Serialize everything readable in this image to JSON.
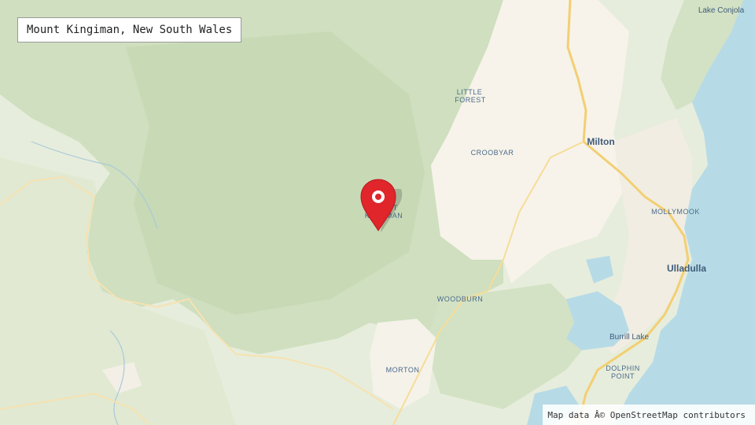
{
  "map": {
    "title": "Mount Kingiman, New South Wales",
    "attribution": "Map data Â© OpenStreetMap contributors",
    "colors": {
      "forest": "#cfdfbf",
      "forest_dark": "#c3d7b1",
      "land": "#e7eddc",
      "urban": "#f7f3ea",
      "water": "#b7dbe6",
      "road": "#f3cf72",
      "marker": "#e0252b"
    },
    "labels": {
      "lake_conjola": "Lake Conjola",
      "little_forest_1": "LITTLE",
      "little_forest_2": "FOREST",
      "croobyar": "CROOBYAR",
      "milton": "Milton",
      "mount_kingiman_1": "MOUNT",
      "mount_kingiman_2": "KINGIMAN",
      "mollymook": "MOLLYMOOK",
      "ulladulla": "Ulladulla",
      "woodburn": "WOODBURN",
      "burrill_lake": "Burrill Lake",
      "morton": "MORTON",
      "dolphin_point_1": "DOLPHIN",
      "dolphin_point_2": "POINT"
    },
    "marker_icon": "map-pin-icon"
  }
}
